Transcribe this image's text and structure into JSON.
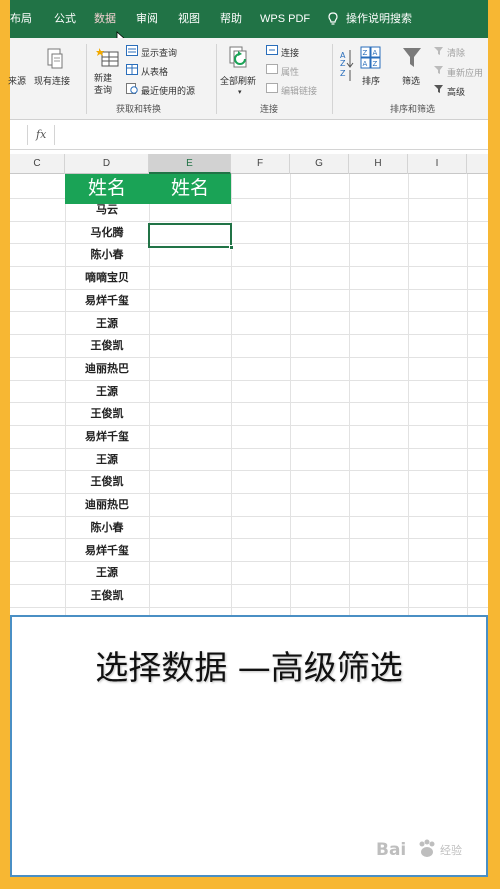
{
  "tabs": [
    {
      "label": "布局",
      "active": false
    },
    {
      "label": "公式",
      "active": false
    },
    {
      "label": "数据",
      "active": true
    },
    {
      "label": "审阅",
      "active": false
    },
    {
      "label": "视图",
      "active": false
    },
    {
      "label": "帮助",
      "active": false
    },
    {
      "label": "WPS PDF",
      "active": false
    },
    {
      "label": "操作说明搜索",
      "active": false
    }
  ],
  "ribbon": {
    "from_source": "来源",
    "existing_connections": "现有连接",
    "new_query": "新建\n查询",
    "show_queries": "显示查询",
    "from_table": "从表格",
    "recent_sources": "最近使用的源",
    "group_get_transform": "获取和转换",
    "refresh_all": "全部刷新",
    "connections": "连接",
    "properties": "属性",
    "edit_links": "编辑链接",
    "group_connections": "连接",
    "sort": "排序",
    "filter": "筛选",
    "clear": "清除",
    "reapply": "重新应用",
    "advanced": "高级",
    "group_sort_filter": "排序和筛选"
  },
  "formula_bar": {
    "fx": "fx",
    "value": ""
  },
  "columns": [
    "C",
    "D",
    "E",
    "F",
    "G",
    "H",
    "I"
  ],
  "selected_column": "E",
  "header_cells": {
    "d": "姓名",
    "e": "姓名"
  },
  "names": [
    "马云",
    "马化腾",
    "陈小春",
    "嘀嘀宝贝",
    "易烊千玺",
    "王源",
    "王俊凯",
    "迪丽热巴",
    "王源",
    "王俊凯",
    "易烊千玺",
    "王源",
    "王俊凯",
    "迪丽热巴",
    "陈小春",
    "易烊千玺",
    "王源",
    "王俊凯"
  ],
  "caption": "选择数据 —高级筛选",
  "watermark": {
    "brand": "Bai",
    "sub": "经验"
  },
  "colors": {
    "excel_green": "#217346",
    "header_fill": "#1aa356",
    "frame_orange": "#f7b733",
    "caption_border": "#4a8fc4"
  }
}
